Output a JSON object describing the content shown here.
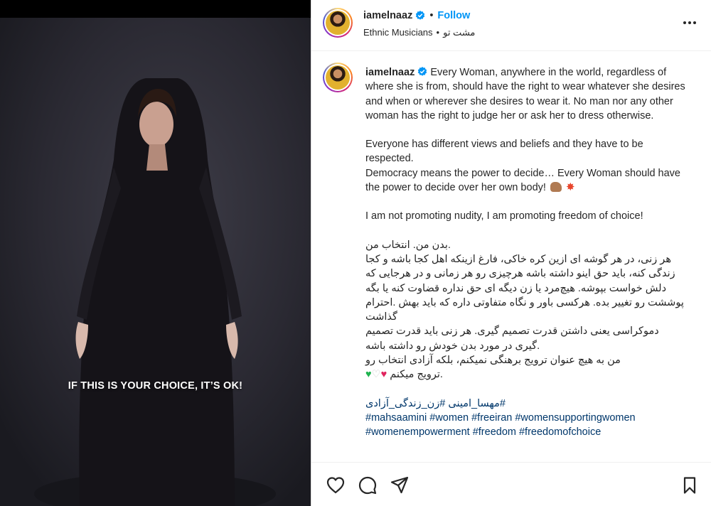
{
  "post": {
    "username": "iamelnaaz",
    "follow_label": "Follow",
    "location": "Ethnic Musicians",
    "audio": "مشت تو",
    "separator": "•"
  },
  "media": {
    "overlay_caption": "IF THIS IS YOUR CHOICE, IT’S OK!"
  },
  "caption": {
    "username": "iamelnaaz",
    "english_p1": "Every Woman, anywhere in the world, regardless of where she is from, should have the right to wear whatever she desires and when or wherever she desires to wear it. No man nor any other woman has the right to judge her or ask her to dress otherwise.",
    "english_p2a": "Everyone has different views and beliefs and they have to be respected.",
    "english_p2b": "Democracy means the power to decide… Every Woman should have the power to decide over her own body!",
    "english_p3": "I am not promoting nudity, I am promoting freedom of choice!",
    "farsi_1": ".بدن من. انتخاب من",
    "farsi_2": "هر زنی، در هر گوشه ای ازین کره خاکی، فارغ ازینکه اهل کجا باشه و کجا زندگی کنه، باید حق اینو داشته باشه هرچیزی رو هر زمانی و در هرجایی که دلش خواست بپوشه. هیچ‌مرد یا زن دیگه ای حق نداره قضاوت کنه یا بگه پوششت رو تغییر بده. هرکسی باور و نگاه متفاوتی داره که باید بهش .احترام گذاشت",
    "farsi_3": "دموکراسی یعنی داشتن قدرت تصمیم گیری. هر زنی باید قدرت تصمیم .گیری در مورد بدن خودش رو داشته باشه",
    "farsi_4": "من به هیچ عنوان ترویج برهنگی نمیکنم، بلکه آزادی انتخاب رو",
    "farsi_5": ".ترویج میکنم",
    "hashtags_line1": "#مهسا_امینی #زن_زندگی_آزادی",
    "hashtags_line2": "#mahsaamini #women #freeiran #womensupportingwomen",
    "hashtags_line3": "#womenempowerment #freedom #freedomofchoice"
  },
  "colors": {
    "accent": "#0095f6",
    "hashtag": "#00376b",
    "text": "#262626"
  },
  "icons": [
    "heart-icon",
    "comment-icon",
    "share-icon",
    "bookmark-icon",
    "more-options-icon",
    "verified-icon"
  ]
}
